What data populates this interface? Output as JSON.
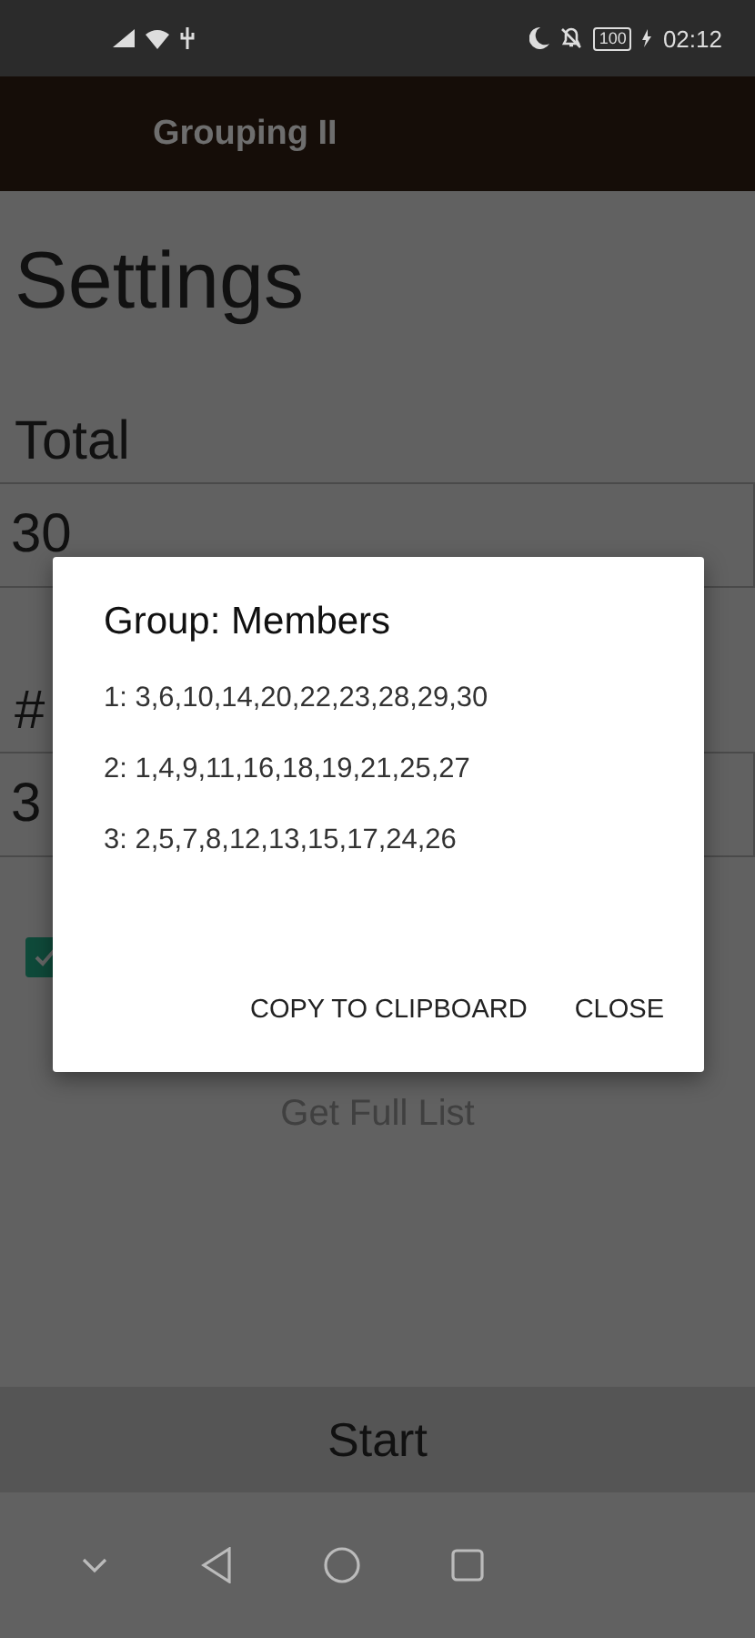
{
  "status_bar": {
    "battery": "100",
    "time": "02:12"
  },
  "app_bar": {
    "title": "Grouping II"
  },
  "page": {
    "heading": "Settings",
    "total_label": "Total",
    "total_value": "30",
    "groups_label": "#",
    "groups_value": "3",
    "checkbox": {
      "checked": true
    },
    "full_list_button": {
      "label": "Get Full List",
      "disabled": true
    },
    "start_button": "Start"
  },
  "dialog": {
    "title": "Group: Members",
    "lines": [
      "1: 3,6,10,14,20,22,23,28,29,30",
      "2: 1,4,9,11,16,18,19,21,25,27",
      "3: 2,5,7,8,12,13,15,17,24,26"
    ],
    "buttons": [
      "COPY TO CLIPBOARD",
      "CLOSE"
    ]
  }
}
